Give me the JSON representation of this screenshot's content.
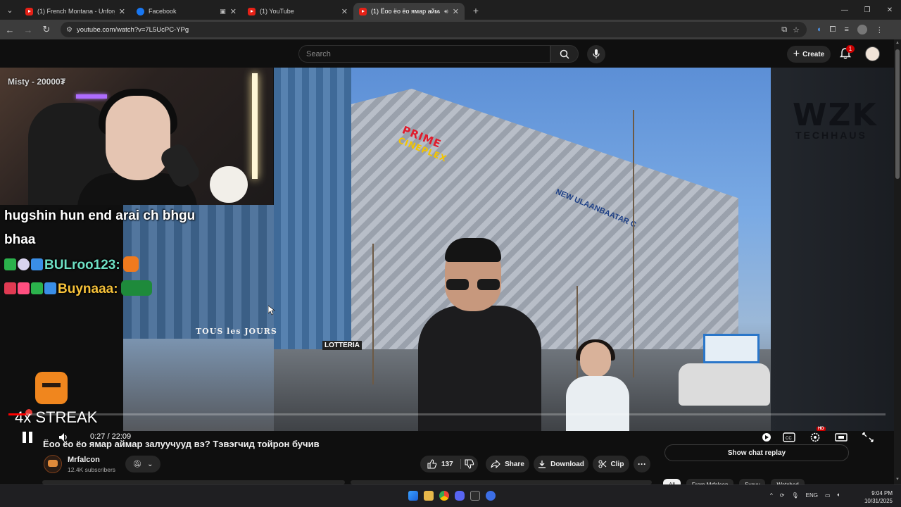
{
  "browser": {
    "tabs": [
      {
        "label": "(1) French Montana - Unforgett",
        "favicon": "youtube-icon",
        "active": false
      },
      {
        "label": "Facebook",
        "favicon": "facebook-icon",
        "active": false
      },
      {
        "label": "(1) YouTube",
        "favicon": "youtube-icon",
        "active": false
      },
      {
        "label": "(1) Ёоо ёо ёо ямар аймар",
        "favicon": "youtube-icon",
        "active": true
      }
    ],
    "url": "youtube.com/watch?v=7L5UcPC-YPg"
  },
  "youtube": {
    "search_placeholder": "Search",
    "create_label": "Create",
    "notification_count": "1"
  },
  "overlay": {
    "streamer_name": "Misty - 20000₮",
    "chat": {
      "line1": "hugshin hun end arai ch bhgu",
      "line2": "bhaa",
      "user1": "BULroo123:",
      "user2": "Buynaaa:"
    },
    "streak": "4x STREAK"
  },
  "video_scene": {
    "sign_prime": "PRIME",
    "sign_cineplex": "CINEPLEX",
    "sign_ulaanbaatar": "NEW ULAANBAATAR C",
    "sign_tous": "TOUS les JOURS",
    "sign_lotteria": "LOTTERIA",
    "sign_wzk": "WZK",
    "sign_techhaus": "TECHHAUS"
  },
  "player": {
    "current_time": "0:27",
    "duration": "22:09",
    "time_display": "0:27 / 22:09",
    "progress_fraction": 0.02,
    "hd_label": "HD"
  },
  "video": {
    "title": "Ёоо ёо ёо ямар аймар залуучууд вэ? Тэвэгчид тойрон бучив",
    "channel_name": "Mrfalcon",
    "subscribers": "12.4K subscribers",
    "like_count": "137",
    "share_label": "Share",
    "download_label": "Download",
    "clip_label": "Clip"
  },
  "sidebar": {
    "chat_replay_label": "Show chat replay",
    "chips": [
      "All",
      "From Mrfalcon",
      "Бусуу",
      "Watched"
    ]
  },
  "taskbar": {
    "language": "ENG",
    "time": "9:04 PM",
    "date": "10/31/2025"
  },
  "colors": {
    "youtube_red": "#ff0000",
    "background": "#0f0f0f"
  }
}
